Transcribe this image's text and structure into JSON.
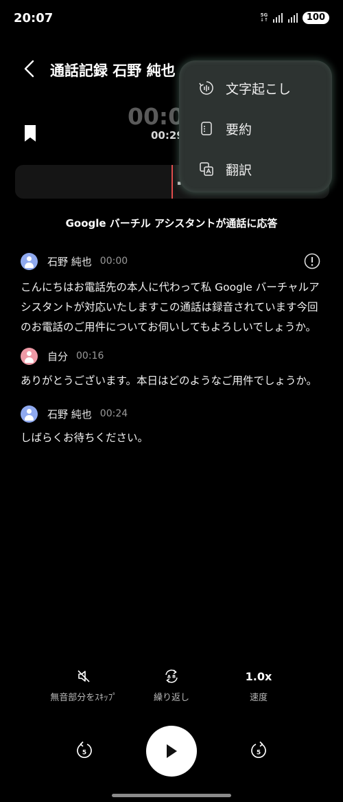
{
  "status_bar": {
    "time": "20:07",
    "network_top": "5G",
    "network_bottom": "↓↑",
    "battery": "100"
  },
  "header": {
    "title": "通話記録 石野 純也",
    "timer": "00:0",
    "subtimer": "00:29"
  },
  "menu": {
    "items": [
      {
        "label": "文字起こし"
      },
      {
        "label": "要約"
      },
      {
        "label": "翻訳"
      }
    ]
  },
  "transcript": {
    "banner": "Google バーチル アシスタントが通話に応答",
    "messages": [
      {
        "speaker": "石野 純也",
        "time": "00:00",
        "text": "こんにちはお電話先の本人に代わって私 Google バーチャルアシスタントが対応いたしますこの通話は録音されています今回のお電話のご用件についてお伺いしてもよろしいでしょうか。"
      },
      {
        "speaker": "自分",
        "time": "00:16",
        "text": "ありがとうございます。本日はどのようなご用件でしょうか。"
      },
      {
        "speaker": "石野 純也",
        "time": "00:24",
        "text": "しばらくお待ちください。"
      }
    ]
  },
  "controls": {
    "skip_silence_label": "無音部分をｽｷｯﾌﾟ",
    "repeat_label": "繰り返し",
    "repeat_icon_letters": "A B",
    "speed_value": "1.0x",
    "speed_label": "速度",
    "rewind_seconds": "5",
    "forward_seconds": "5"
  },
  "colors": {
    "background": "#000000",
    "menu_bg": "#2d3331",
    "playhead": "#e24c4c",
    "avatar_other": "#8fa9ef",
    "avatar_self": "#ee9aa6"
  }
}
